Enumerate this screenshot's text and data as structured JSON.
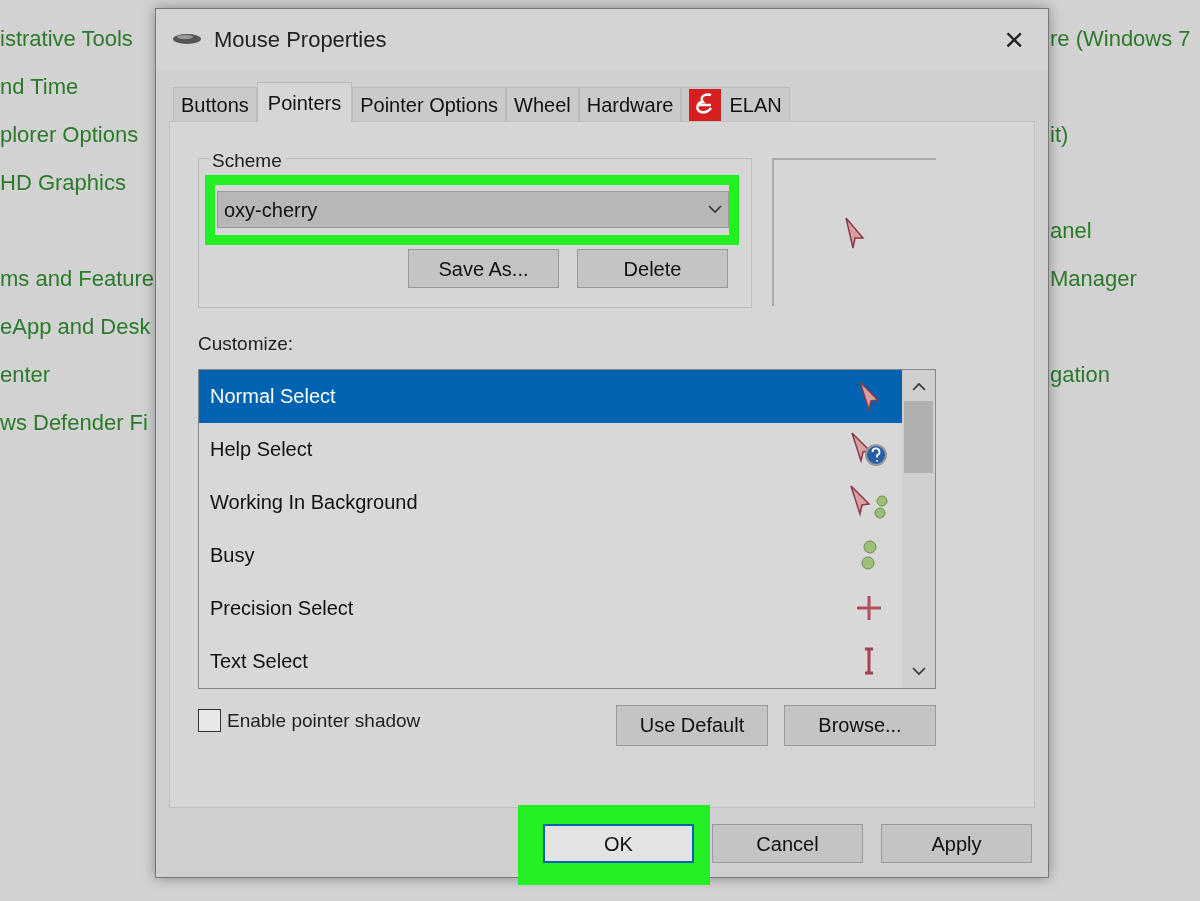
{
  "background_left": {
    "items": [
      {
        "label": "istrative Tools"
      },
      {
        "label": "nd Time"
      },
      {
        "label": "plorer Options"
      },
      {
        "label": "HD Graphics"
      },
      {
        "label": "ms and Feature"
      },
      {
        "label": "eApp and Desk"
      },
      {
        "label": "enter"
      },
      {
        "label": "ws Defender Fi"
      }
    ]
  },
  "background_right": {
    "items": [
      {
        "label": "re (Windows 7"
      },
      {
        "label": "it)"
      },
      {
        "label": "anel"
      },
      {
        "label": "Manager"
      },
      {
        "label": "gation"
      }
    ]
  },
  "window": {
    "title": "Mouse Properties",
    "close": "×"
  },
  "tabs": [
    {
      "label": "Buttons",
      "selected": false
    },
    {
      "label": "Pointers",
      "selected": true
    },
    {
      "label": "Pointer Options",
      "selected": false
    },
    {
      "label": "Wheel",
      "selected": false
    },
    {
      "label": "Hardware",
      "selected": false
    },
    {
      "label": "ELAN",
      "selected": false,
      "icon": true
    }
  ],
  "scheme": {
    "label": "Scheme",
    "value": "oxy-cherry",
    "highlighted": true,
    "buttons": [
      "Save As...",
      "Delete"
    ]
  },
  "customize": {
    "label": "Customize:",
    "rows": [
      {
        "label": "Normal Select",
        "kind": "arrow",
        "selected": true
      },
      {
        "label": "Help Select",
        "kind": "help",
        "selected": false
      },
      {
        "label": "Working In Background",
        "kind": "working",
        "selected": false
      },
      {
        "label": "Busy",
        "kind": "busy",
        "selected": false
      },
      {
        "label": "Precision Select",
        "kind": "cross",
        "selected": false
      },
      {
        "label": "Text Select",
        "kind": "ibeam",
        "selected": false
      }
    ]
  },
  "shadow": {
    "label": "Enable pointer shadow",
    "checked": false
  },
  "list_buttons": [
    "Use Default",
    "Browse..."
  ],
  "footer_buttons": [
    {
      "label": "OK",
      "highlighted": true
    },
    {
      "label": "Cancel",
      "highlighted": false
    },
    {
      "label": "Apply",
      "highlighted": false
    }
  ]
}
